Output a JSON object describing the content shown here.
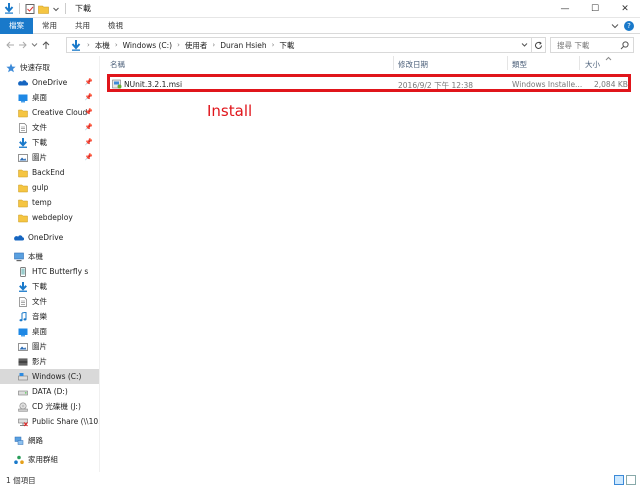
{
  "window": {
    "title": "下載",
    "controls": {
      "minimize": "—",
      "maximize": "☐",
      "close": "✕"
    }
  },
  "ribbon": {
    "tabs": [
      "檔案",
      "常用",
      "共用",
      "檢視"
    ],
    "help": "?"
  },
  "address": {
    "crumbs": [
      "本機",
      "Windows (C:)",
      "使用者",
      "Duran Hsieh",
      "下載"
    ],
    "search_placeholder": "搜尋 下載"
  },
  "nav": {
    "quick_access": "快速存取",
    "items": [
      {
        "label": "OneDrive",
        "icon": "onedrive-icon",
        "pinned": true
      },
      {
        "label": "桌面",
        "icon": "desktop-icon",
        "pinned": true
      },
      {
        "label": "Creative Cloud",
        "icon": "folder-icon",
        "pinned": true
      },
      {
        "label": "文件",
        "icon": "documents-icon",
        "pinned": true
      },
      {
        "label": "下載",
        "icon": "download-icon",
        "pinned": true
      },
      {
        "label": "圖片",
        "icon": "pictures-icon",
        "pinned": true
      },
      {
        "label": "BackEnd",
        "icon": "folder-icon",
        "pinned": false
      },
      {
        "label": "gulp",
        "icon": "folder-icon",
        "pinned": false
      },
      {
        "label": "temp",
        "icon": "folder-icon",
        "pinned": false
      },
      {
        "label": "webdeploy",
        "icon": "folder-icon",
        "pinned": false
      }
    ],
    "onedrive": "OneDrive",
    "this_pc": "本機",
    "pc_items": [
      {
        "label": "HTC Butterfly s",
        "icon": "phone-icon"
      },
      {
        "label": "下載",
        "icon": "download-icon"
      },
      {
        "label": "文件",
        "icon": "documents-icon"
      },
      {
        "label": "音樂",
        "icon": "music-icon"
      },
      {
        "label": "桌面",
        "icon": "desktop-icon"
      },
      {
        "label": "圖片",
        "icon": "pictures-icon"
      },
      {
        "label": "影片",
        "icon": "video-icon"
      },
      {
        "label": "Windows (C:)",
        "icon": "drive-icon"
      },
      {
        "label": "DATA (D:)",
        "icon": "drive-icon"
      },
      {
        "label": "CD 光碟機 (J:)",
        "icon": "cd-drive-icon"
      },
      {
        "label": "Public Share (\\\\10.",
        "icon": "network-drive-icon"
      }
    ],
    "network": "網路",
    "homegroup": "家用群組"
  },
  "columns": {
    "name": "名稱",
    "modified": "修改日期",
    "type": "類型",
    "size": "大小"
  },
  "files": [
    {
      "name": "NUnit.3.2.1.msi",
      "modified": "2016/9/2 下午 12:38",
      "type": "Windows Installe...",
      "size": "2,084 KB"
    }
  ],
  "annotation": "Install",
  "status": {
    "count": "1 個項目"
  },
  "colors": {
    "accent": "#1979ca",
    "highlight": "#e0151b",
    "selected": "#cce8ff"
  }
}
